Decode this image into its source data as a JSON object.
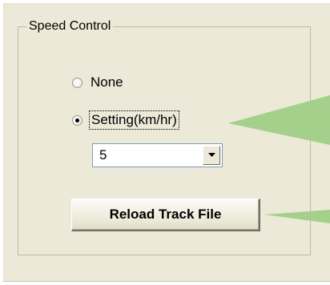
{
  "group": {
    "title": "Speed Control"
  },
  "options": {
    "none_label": "None",
    "setting_label": "Setting(km/hr)",
    "selected": "setting"
  },
  "speed_dropdown": {
    "value": "5"
  },
  "buttons": {
    "reload_label": "Reload Track File"
  },
  "colors": {
    "panel_background": "#ece9d8",
    "callout_green": "#a5d08b"
  },
  "icons": {
    "dropdown_arrow": "chevron-down-icon"
  }
}
